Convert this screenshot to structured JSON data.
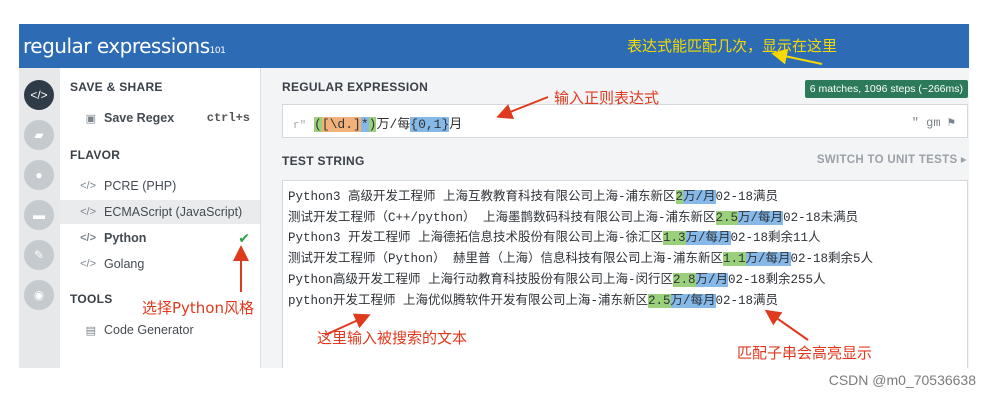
{
  "header": {
    "logo_main": "regular expressions",
    "logo_version": "101"
  },
  "sidebar": {
    "save_share_heading": "SAVE & SHARE",
    "save_label": "Save Regex",
    "save_shortcut": "ctrl+s",
    "flavor_heading": "FLAVOR",
    "flavors": [
      "PCRE (PHP)",
      "ECMAScript (JavaScript)",
      "Python",
      "Golang"
    ],
    "selected_flavor": "Python",
    "tools_heading": "TOOLS",
    "tools": [
      "Code Generator"
    ]
  },
  "regex": {
    "heading": "REGULAR EXPRESSION",
    "prefix": "r\"",
    "tokens": [
      "(",
      "[\\d.]",
      "*",
      ")",
      "万/每",
      "{0,1}",
      "月"
    ],
    "flags": "\" gm",
    "match_info": "6 matches, 1096 steps (~266ms)"
  },
  "test": {
    "heading": "TEST STRING",
    "switch_label": "SWITCH TO UNIT TESTS ▸",
    "lines": [
      [
        "Python3 高级开发工程师 上海互教教育科技有限公司上海-浦东新区",
        "2",
        "万/月",
        "02-18满员"
      ],
      [
        "测试开发工程师（C++/python） 上海墨鹊数码科技有限公司上海-浦东新区",
        "2.5",
        "万/每月",
        "02-18未满员"
      ],
      [
        "Python3 开发工程师 上海德拓信息技术股份有限公司上海-徐汇区",
        "1.3",
        "万/每月",
        "02-18剩余11人"
      ],
      [
        "测试开发工程师（Python） 赫里普（上海）信息科技有限公司上海-浦东新区",
        "1.1",
        "万/每月",
        "02-18剩余5人"
      ],
      [
        "Python高级开发工程师 上海行动教育科技股份有限公司上海-闵行区",
        "2.8",
        "万/月",
        "02-18剩余255人"
      ],
      [
        "python开发工程师 上海优似腾软件开发有限公司上海-浦东新区",
        "2.5",
        "万/每月",
        "02-18满员"
      ]
    ]
  },
  "annotations": {
    "top_right": "表达式能匹配几次，显示在这里",
    "regex_input": "输入正则表达式",
    "flavor_select": "选择Python风格",
    "test_input": "这里输入被搜索的文本",
    "highlight": "匹配子串会高亮显示"
  },
  "watermark": "CSDN @m0_70536638",
  "colors": {
    "topbar": "#2d6cb5",
    "match_badge": "#2c7a5a",
    "annotation": "#e03a1e",
    "annotation_top": "#f5d900",
    "group_green": "#9ad079",
    "quant_blue": "#86b8e8"
  }
}
